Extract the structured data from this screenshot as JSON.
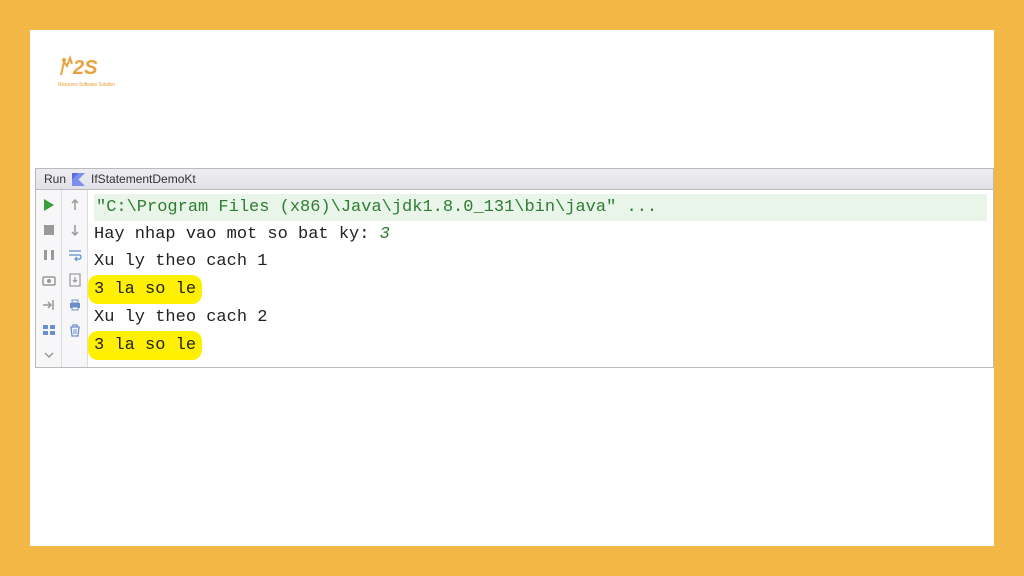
{
  "logo": {
    "tagline": "Resource Software Solution"
  },
  "run": {
    "label": "Run",
    "config_name": "IfStatementDemoKt"
  },
  "console": {
    "command": "\"C:\\Program Files (x86)\\Java\\jdk1.8.0_131\\bin\\java\" ...",
    "prompt": "Hay nhap vao mot so bat ky: ",
    "input_value": "3",
    "line1": "Xu ly theo cach 1",
    "result1": "3 la so le",
    "line2": "Xu ly theo cach 2",
    "result2": "3 la so le"
  }
}
